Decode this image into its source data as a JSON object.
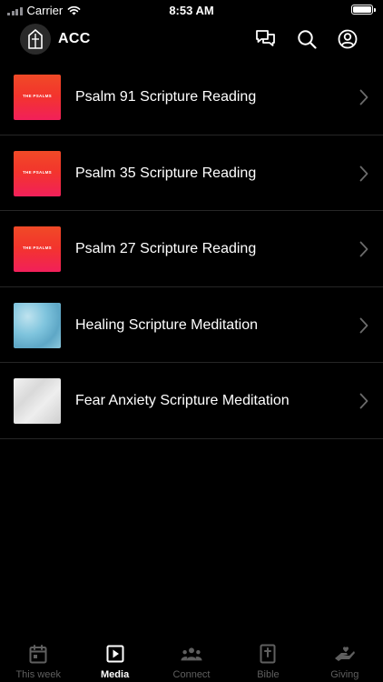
{
  "status_bar": {
    "carrier": "Carrier",
    "time": "8:53 AM",
    "icons": [
      "signal-icon",
      "wifi-icon",
      "battery-icon"
    ]
  },
  "header": {
    "app_name": "ACC",
    "logo_icon": "church-logo-icon",
    "actions": [
      {
        "name": "chat-icon"
      },
      {
        "name": "search-icon"
      },
      {
        "name": "profile-icon"
      }
    ]
  },
  "media": {
    "items": [
      {
        "title": "Psalm 91 Scripture Reading",
        "thumb_text": "THE PSALMS",
        "thumb_style": "psalms-gradient"
      },
      {
        "title": "Psalm 35 Scripture Reading",
        "thumb_text": "THE PSALMS",
        "thumb_style": "psalms-gradient"
      },
      {
        "title": "Psalm 27 Scripture Reading",
        "thumb_text": "THE PSALMS",
        "thumb_style": "psalms-gradient"
      },
      {
        "title": "Healing Scripture Meditation",
        "thumb_style": "ice-texture"
      },
      {
        "title": "Fear Anxiety Scripture Meditation",
        "thumb_style": "marble-texture"
      }
    ]
  },
  "tab_bar": {
    "active": "Media",
    "tabs": [
      {
        "label": "This week",
        "icon": "calendar-icon"
      },
      {
        "label": "Media",
        "icon": "play-icon"
      },
      {
        "label": "Connect",
        "icon": "group-icon"
      },
      {
        "label": "Bible",
        "icon": "bible-icon"
      },
      {
        "label": "Giving",
        "icon": "giving-hand-icon"
      }
    ]
  },
  "colors": {
    "background": "#000000",
    "text": "#ffffff",
    "inactive_tab": "#5f5f5f",
    "divider": "#262626",
    "psalms_top": "#f04a27",
    "psalms_bottom": "#f2205a"
  }
}
